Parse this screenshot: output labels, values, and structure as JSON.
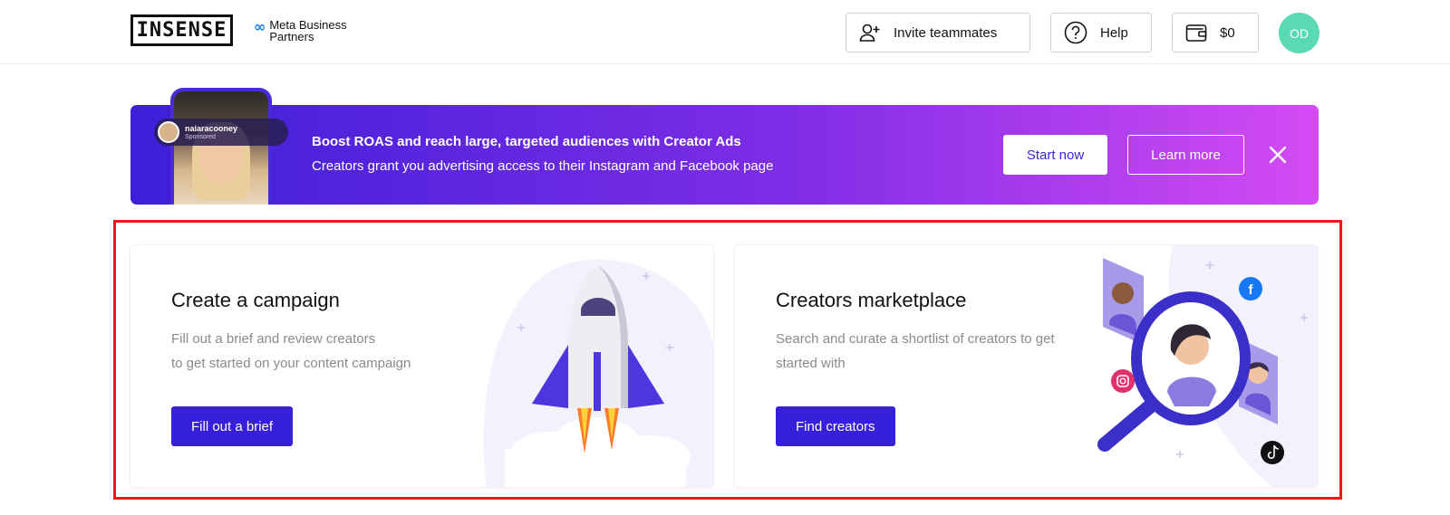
{
  "header": {
    "logo": "INSENSE",
    "meta_badge": {
      "line1": "Meta Business",
      "line2": "Partners"
    },
    "invite_label": "Invite teammates",
    "help_label": "Help",
    "wallet_label": "$0",
    "avatar_initials": "OD"
  },
  "banner": {
    "phone_username": "naiaracooney",
    "phone_sponsored": "Sponsored",
    "title": "Boost ROAS and reach large, targeted audiences with Creator Ads",
    "subtitle": "Creators grant you advertising access to their Instagram and Facebook page",
    "start_label": "Start now",
    "learn_label": "Learn more"
  },
  "cards": {
    "campaign": {
      "title": "Create a campaign",
      "desc_line1": "Fill out a brief and review creators",
      "desc_line2": "to get started on your content campaign",
      "button": "Fill out a brief"
    },
    "marketplace": {
      "title": "Creators marketplace",
      "desc_line1": "Search and curate a shortlist of creators to get",
      "desc_line2": "started with",
      "button": "Find creators"
    }
  },
  "colors": {
    "accent": "#3720d9",
    "banner_start": "#3d1fd8",
    "banner_end": "#d44bf3",
    "avatar": "#5bd9b3",
    "highlight_outline": "#f01919"
  }
}
